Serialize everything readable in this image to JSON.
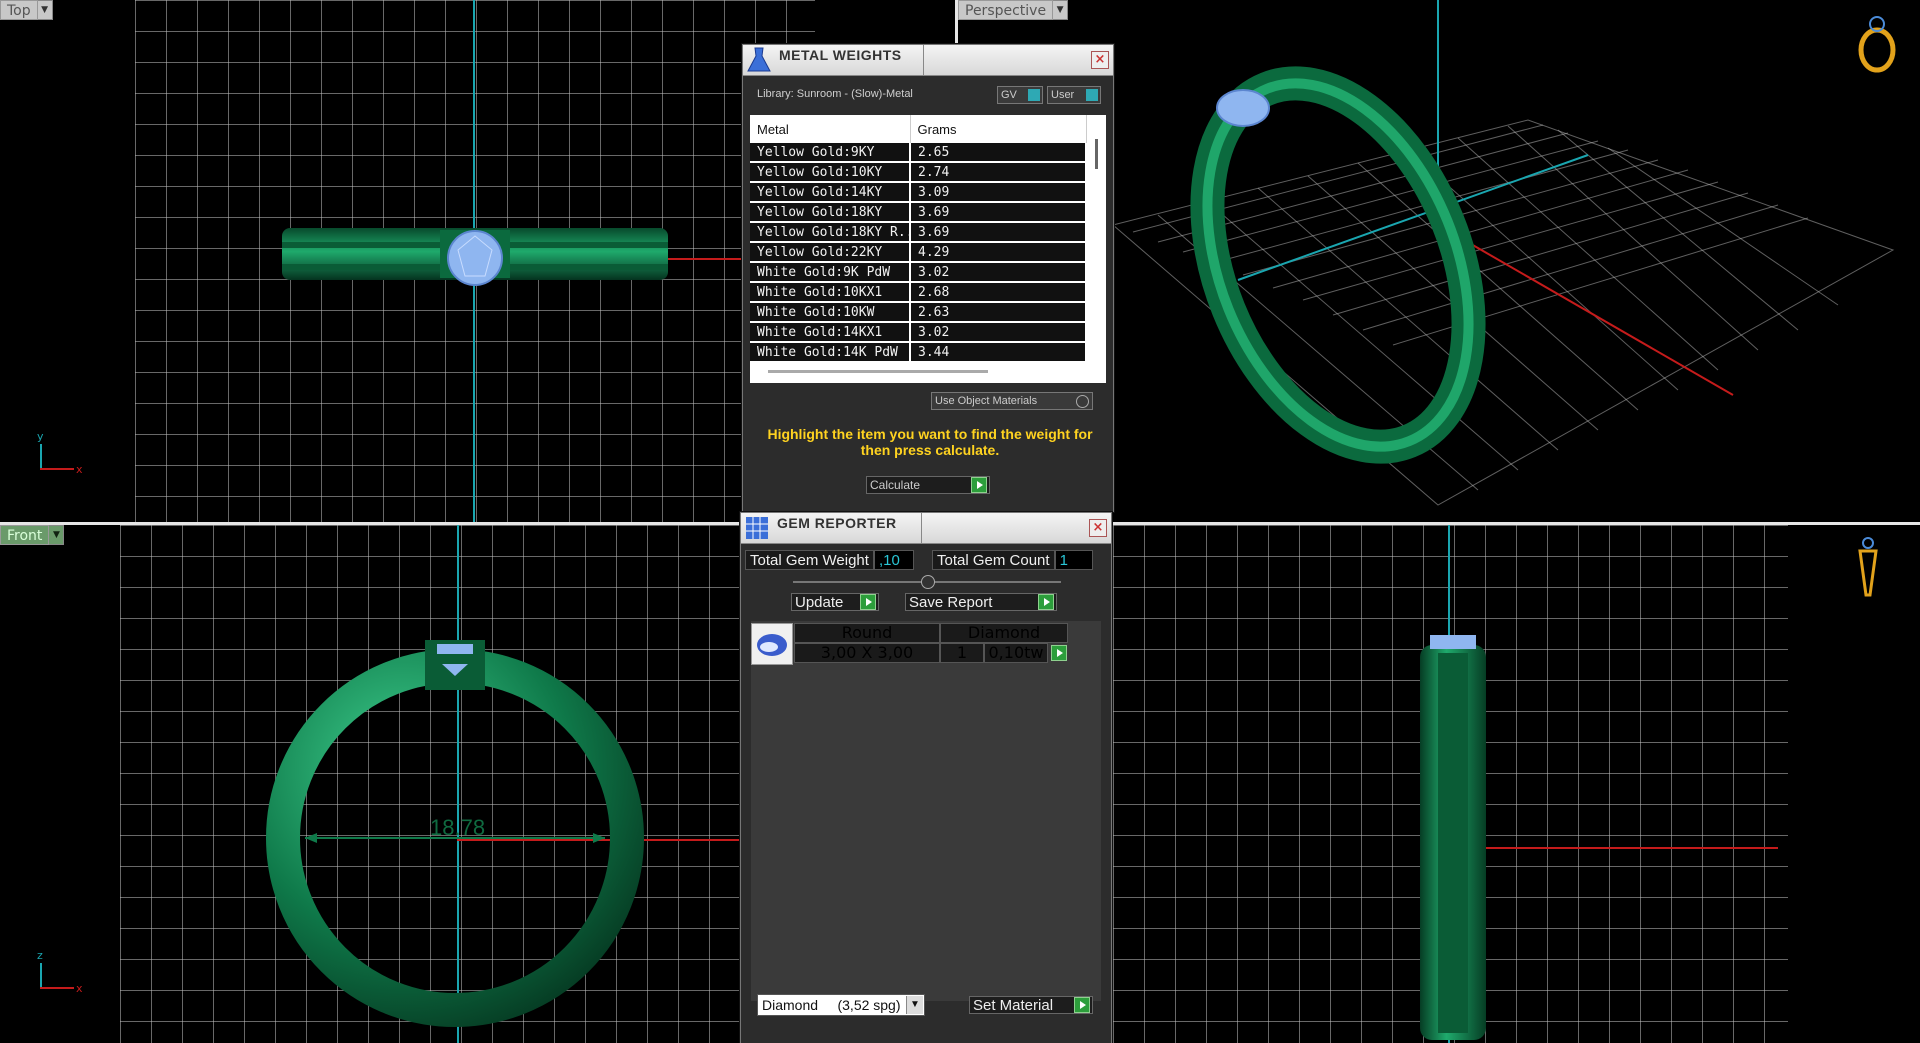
{
  "viewports": {
    "top": {
      "label": "Top"
    },
    "perspective": {
      "label": "Perspective"
    },
    "front": {
      "label": "Front",
      "dimension": "18.78"
    },
    "side": {
      "label": ""
    }
  },
  "axes": {
    "y": "y",
    "x": "x",
    "z": "z"
  },
  "metal_weights": {
    "title": "METAL WEIGHTS",
    "library": "Library: Sunroom - (Slow)-Metal",
    "gv_label": "GV",
    "user_label": "User",
    "columns": [
      "Metal",
      "Grams"
    ],
    "rows": [
      {
        "metal": "Yellow Gold:9KY",
        "grams": "2.65"
      },
      {
        "metal": "Yellow Gold:10KY",
        "grams": "2.74"
      },
      {
        "metal": "Yellow Gold:14KY",
        "grams": "3.09"
      },
      {
        "metal": "Yellow Gold:18KY",
        "grams": "3.69"
      },
      {
        "metal": "Yellow Gold:18KY R...",
        "grams": "3.69"
      },
      {
        "metal": "Yellow Gold:22KY",
        "grams": "4.29"
      },
      {
        "metal": "White Gold:9K PdW",
        "grams": "3.02"
      },
      {
        "metal": "White Gold:10KX1",
        "grams": "2.68"
      },
      {
        "metal": "White Gold:10KW",
        "grams": "2.63"
      },
      {
        "metal": "White Gold:14KX1",
        "grams": "3.02"
      },
      {
        "metal": "White Gold:14K PdW",
        "grams": "3.44"
      }
    ],
    "use_object_materials": "Use Object Materials",
    "hint": "Highlight the item you want to find the weight for then press calculate.",
    "calculate": "Calculate"
  },
  "gem_reporter": {
    "title": "GEM REPORTER",
    "total_gem_weight_label": "Total Gem Weight",
    "total_gem_weight": ",10",
    "total_gem_count_label": "Total Gem Count",
    "total_gem_count": "1",
    "update": "Update",
    "save_report": "Save Report",
    "gem": {
      "shape": "Round",
      "material": "Diamond",
      "size": "3,00 X 3,00",
      "count": "1",
      "weight": "0,10tw"
    },
    "material_select": "Diamond     (3,52 spg)",
    "set_material": "Set Material"
  },
  "colors": {
    "accent_cyan": "#1aa6b0",
    "axis_red": "#c51b1b",
    "ring_green": "#0f7a4a",
    "hint_yellow": "#ffd320"
  }
}
